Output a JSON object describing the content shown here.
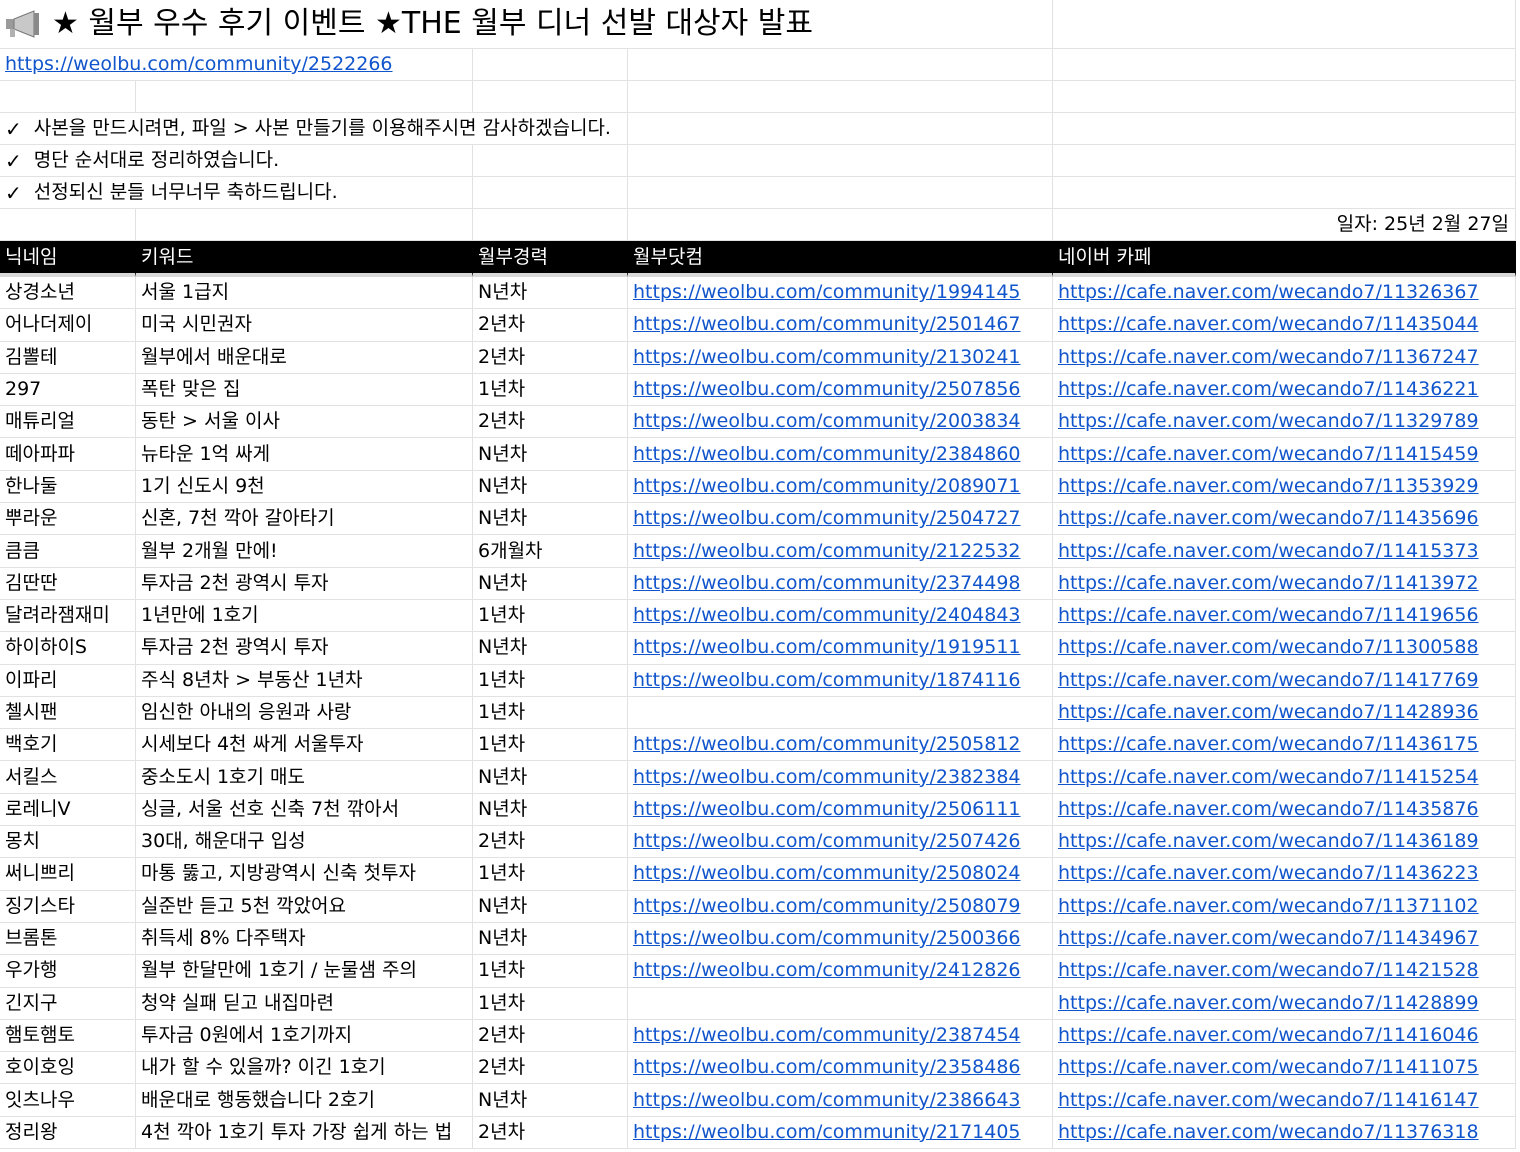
{
  "title": "★ 월부 우수 후기 이벤트 ★THE 월부 디너 선발 대상자 발표",
  "megaphone_icon": "megaphone-icon",
  "announcement_url": "https://weolbu.com/community/2522266",
  "notes": [
    "사본을 만드시려면, 파일 > 사본 만들기를 이용해주시면 감사하겠습니다.",
    "명단 순서대로 정리하였습니다.",
    "선정되신 분들 너무너무 축하드립니다."
  ],
  "check_glyph": "✓",
  "date_label": "일자: 25년 2월 27일",
  "columns": [
    "닉네임",
    "키워드",
    "월부경력",
    "월부닷컴",
    "네이버 카페"
  ],
  "rows": [
    {
      "nick": "상경소년",
      "keyword": "서울 1급지",
      "career": "N년차",
      "weolbu": "https://weolbu.com/community/1994145",
      "naver": "https://cafe.naver.com/wecando7/11326367"
    },
    {
      "nick": "어나더제이",
      "keyword": "미국 시민권자",
      "career": "2년차",
      "weolbu": "https://weolbu.com/community/2501467",
      "naver": "https://cafe.naver.com/wecando7/11435044"
    },
    {
      "nick": "김뽈테",
      "keyword": "월부에서 배운대로",
      "career": "2년차",
      "weolbu": "https://weolbu.com/community/2130241",
      "naver": "https://cafe.naver.com/wecando7/11367247"
    },
    {
      "nick": "297",
      "keyword": "폭탄 맞은 집",
      "career": "1년차",
      "weolbu": "https://weolbu.com/community/2507856",
      "naver": "https://cafe.naver.com/wecando7/11436221"
    },
    {
      "nick": "매튜리얼",
      "keyword": "동탄 > 서울 이사",
      "career": "2년차",
      "weolbu": "https://weolbu.com/community/2003834",
      "naver": "https://cafe.naver.com/wecando7/11329789"
    },
    {
      "nick": "떼아파파",
      "keyword": "뉴타운 1억 싸게",
      "career": "N년차",
      "weolbu": "https://weolbu.com/community/2384860",
      "naver": "https://cafe.naver.com/wecando7/11415459"
    },
    {
      "nick": "한나둘",
      "keyword": "1기 신도시 9천",
      "career": "N년차",
      "weolbu": "https://weolbu.com/community/2089071",
      "naver": "https://cafe.naver.com/wecando7/11353929"
    },
    {
      "nick": "뿌라운",
      "keyword": "신혼, 7천 깍아 갈아타기",
      "career": "N년차",
      "weolbu": "https://weolbu.com/community/2504727",
      "naver": "https://cafe.naver.com/wecando7/11435696"
    },
    {
      "nick": "큼큼",
      "keyword": "월부 2개월 만에!",
      "career": "6개월차",
      "weolbu": "https://weolbu.com/community/2122532",
      "naver": "https://cafe.naver.com/wecando7/11415373"
    },
    {
      "nick": "김딴딴",
      "keyword": "투자금 2천 광역시 투자",
      "career": "N년차",
      "weolbu": "https://weolbu.com/community/2374498",
      "naver": "https://cafe.naver.com/wecando7/11413972"
    },
    {
      "nick": "달려라잼재미",
      "keyword": "1년만에 1호기",
      "career": "1년차",
      "weolbu": "https://weolbu.com/community/2404843",
      "naver": "https://cafe.naver.com/wecando7/11419656"
    },
    {
      "nick": "하이하이S",
      "keyword": "투자금 2천 광역시 투자",
      "career": "N년차",
      "weolbu": "https://weolbu.com/community/1919511",
      "naver": "https://cafe.naver.com/wecando7/11300588"
    },
    {
      "nick": "이파리",
      "keyword": "주식 8년차 > 부동산 1년차",
      "career": "1년차",
      "weolbu": "https://weolbu.com/community/1874116",
      "naver": "https://cafe.naver.com/wecando7/11417769"
    },
    {
      "nick": "첼시팬",
      "keyword": "임신한 아내의 응원과 사랑",
      "career": "1년차",
      "weolbu": "",
      "naver": "https://cafe.naver.com/wecando7/11428936"
    },
    {
      "nick": "백호기",
      "keyword": "시세보다 4천 싸게 서울투자",
      "career": "1년차",
      "weolbu": "https://weolbu.com/community/2505812",
      "naver": "https://cafe.naver.com/wecando7/11436175"
    },
    {
      "nick": "서킬스",
      "keyword": "중소도시 1호기 매도",
      "career": "N년차",
      "weolbu": "https://weolbu.com/community/2382384",
      "naver": "https://cafe.naver.com/wecando7/11415254"
    },
    {
      "nick": "로레니V",
      "keyword": "싱글, 서울 선호 신축 7천 깎아서",
      "career": "N년차",
      "weolbu": "https://weolbu.com/community/2506111",
      "naver": "https://cafe.naver.com/wecando7/11435876"
    },
    {
      "nick": "몽치",
      "keyword": "30대, 해운대구 입성",
      "career": "2년차",
      "weolbu": "https://weolbu.com/community/2507426",
      "naver": "https://cafe.naver.com/wecando7/11436189"
    },
    {
      "nick": "써니쁘리",
      "keyword": "마통 뚫고, 지방광역시 신축 첫투자",
      "career": "1년차",
      "weolbu": "https://weolbu.com/community/2508024",
      "naver": "https://cafe.naver.com/wecando7/11436223"
    },
    {
      "nick": "징기스타",
      "keyword": "실준반 듣고 5천 깍았어요",
      "career": "N년차",
      "weolbu": "https://weolbu.com/community/2508079",
      "naver": "https://cafe.naver.com/wecando7/11371102"
    },
    {
      "nick": "브롬톤",
      "keyword": "취득세 8% 다주택자",
      "career": "N년차",
      "weolbu": "https://weolbu.com/community/2500366",
      "naver": "https://cafe.naver.com/wecando7/11434967"
    },
    {
      "nick": "우가행",
      "keyword": "월부 한달만에 1호기 / 눈물샘 주의",
      "career": "1년차",
      "weolbu": "https://weolbu.com/community/2412826",
      "naver": "https://cafe.naver.com/wecando7/11421528"
    },
    {
      "nick": "긴지구",
      "keyword": "청약 실패 딛고 내집마련",
      "career": "1년차",
      "weolbu": "",
      "naver": "https://cafe.naver.com/wecando7/11428899"
    },
    {
      "nick": "햄토햄토",
      "keyword": "투자금 0원에서 1호기까지",
      "career": "2년차",
      "weolbu": "https://weolbu.com/community/2387454",
      "naver": "https://cafe.naver.com/wecando7/11416046"
    },
    {
      "nick": "호이호잉",
      "keyword": "내가 할 수 있을까? 이긴 1호기",
      "career": "2년차",
      "weolbu": "https://weolbu.com/community/2358486",
      "naver": "https://cafe.naver.com/wecando7/11411075"
    },
    {
      "nick": "잇츠나우",
      "keyword": "배운대로 행동했습니다 2호기",
      "career": "N년차",
      "weolbu": "https://weolbu.com/community/2386643",
      "naver": "https://cafe.naver.com/wecando7/11416147"
    },
    {
      "nick": "정리왕",
      "keyword": "4천 깍아 1호기 투자 가장 쉽게 하는 법",
      "career": "2년차",
      "weolbu": "https://weolbu.com/community/2171405",
      "naver": "https://cafe.naver.com/wecando7/11376318"
    }
  ]
}
